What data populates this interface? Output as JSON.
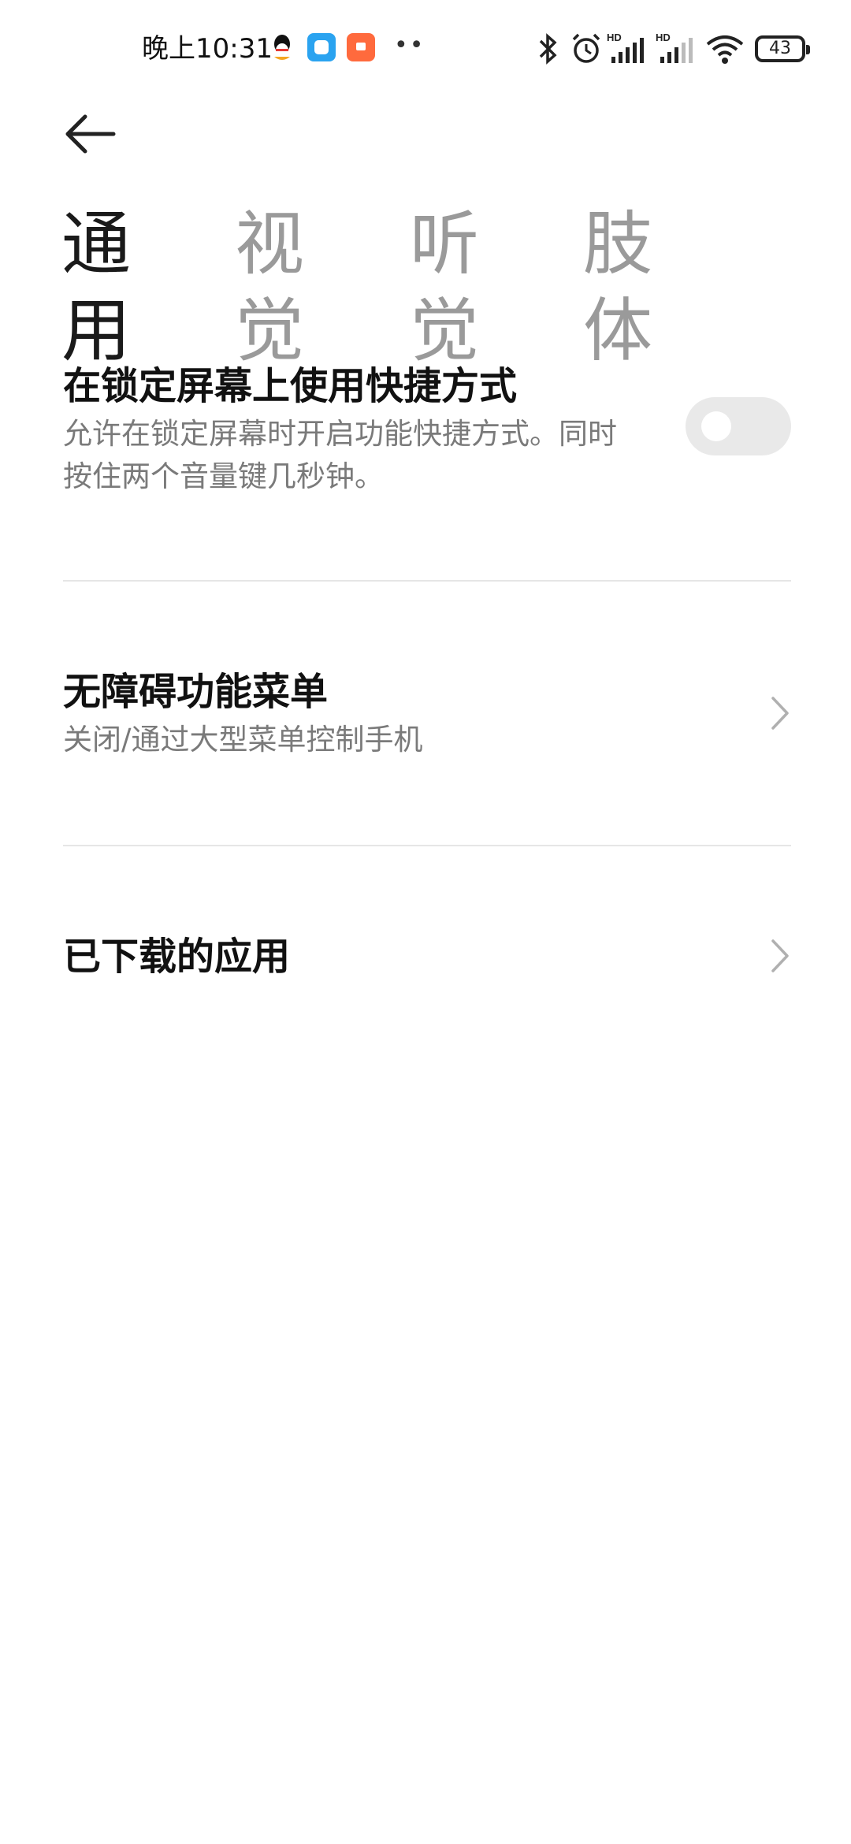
{
  "status_bar": {
    "time": "晚上10:31",
    "more_dots": "••",
    "battery_level": "43"
  },
  "tabs": [
    {
      "label": "通用",
      "active": true
    },
    {
      "label": "视觉",
      "active": false
    },
    {
      "label": "听觉",
      "active": false
    },
    {
      "label": "肢体",
      "active": false
    }
  ],
  "settings": {
    "lock_screen_shortcut": {
      "title": "在锁定屏幕上使用快捷方式",
      "description_line1": "允许在锁定屏幕时开启功能快捷方式。同时",
      "description_line2": "按住两个音量键几秒钟。",
      "toggle_on": false
    },
    "accessibility_menu": {
      "title": "无障碍功能菜单",
      "description": "关闭/通过大型菜单控制手机"
    },
    "downloaded_apps": {
      "title": "已下载的应用"
    }
  },
  "colors": {
    "active_tab": "#1a1a1a",
    "inactive_tab": "#9a9a9a",
    "description": "#7a7a7a",
    "toggle_off": "#e9e9e9"
  }
}
